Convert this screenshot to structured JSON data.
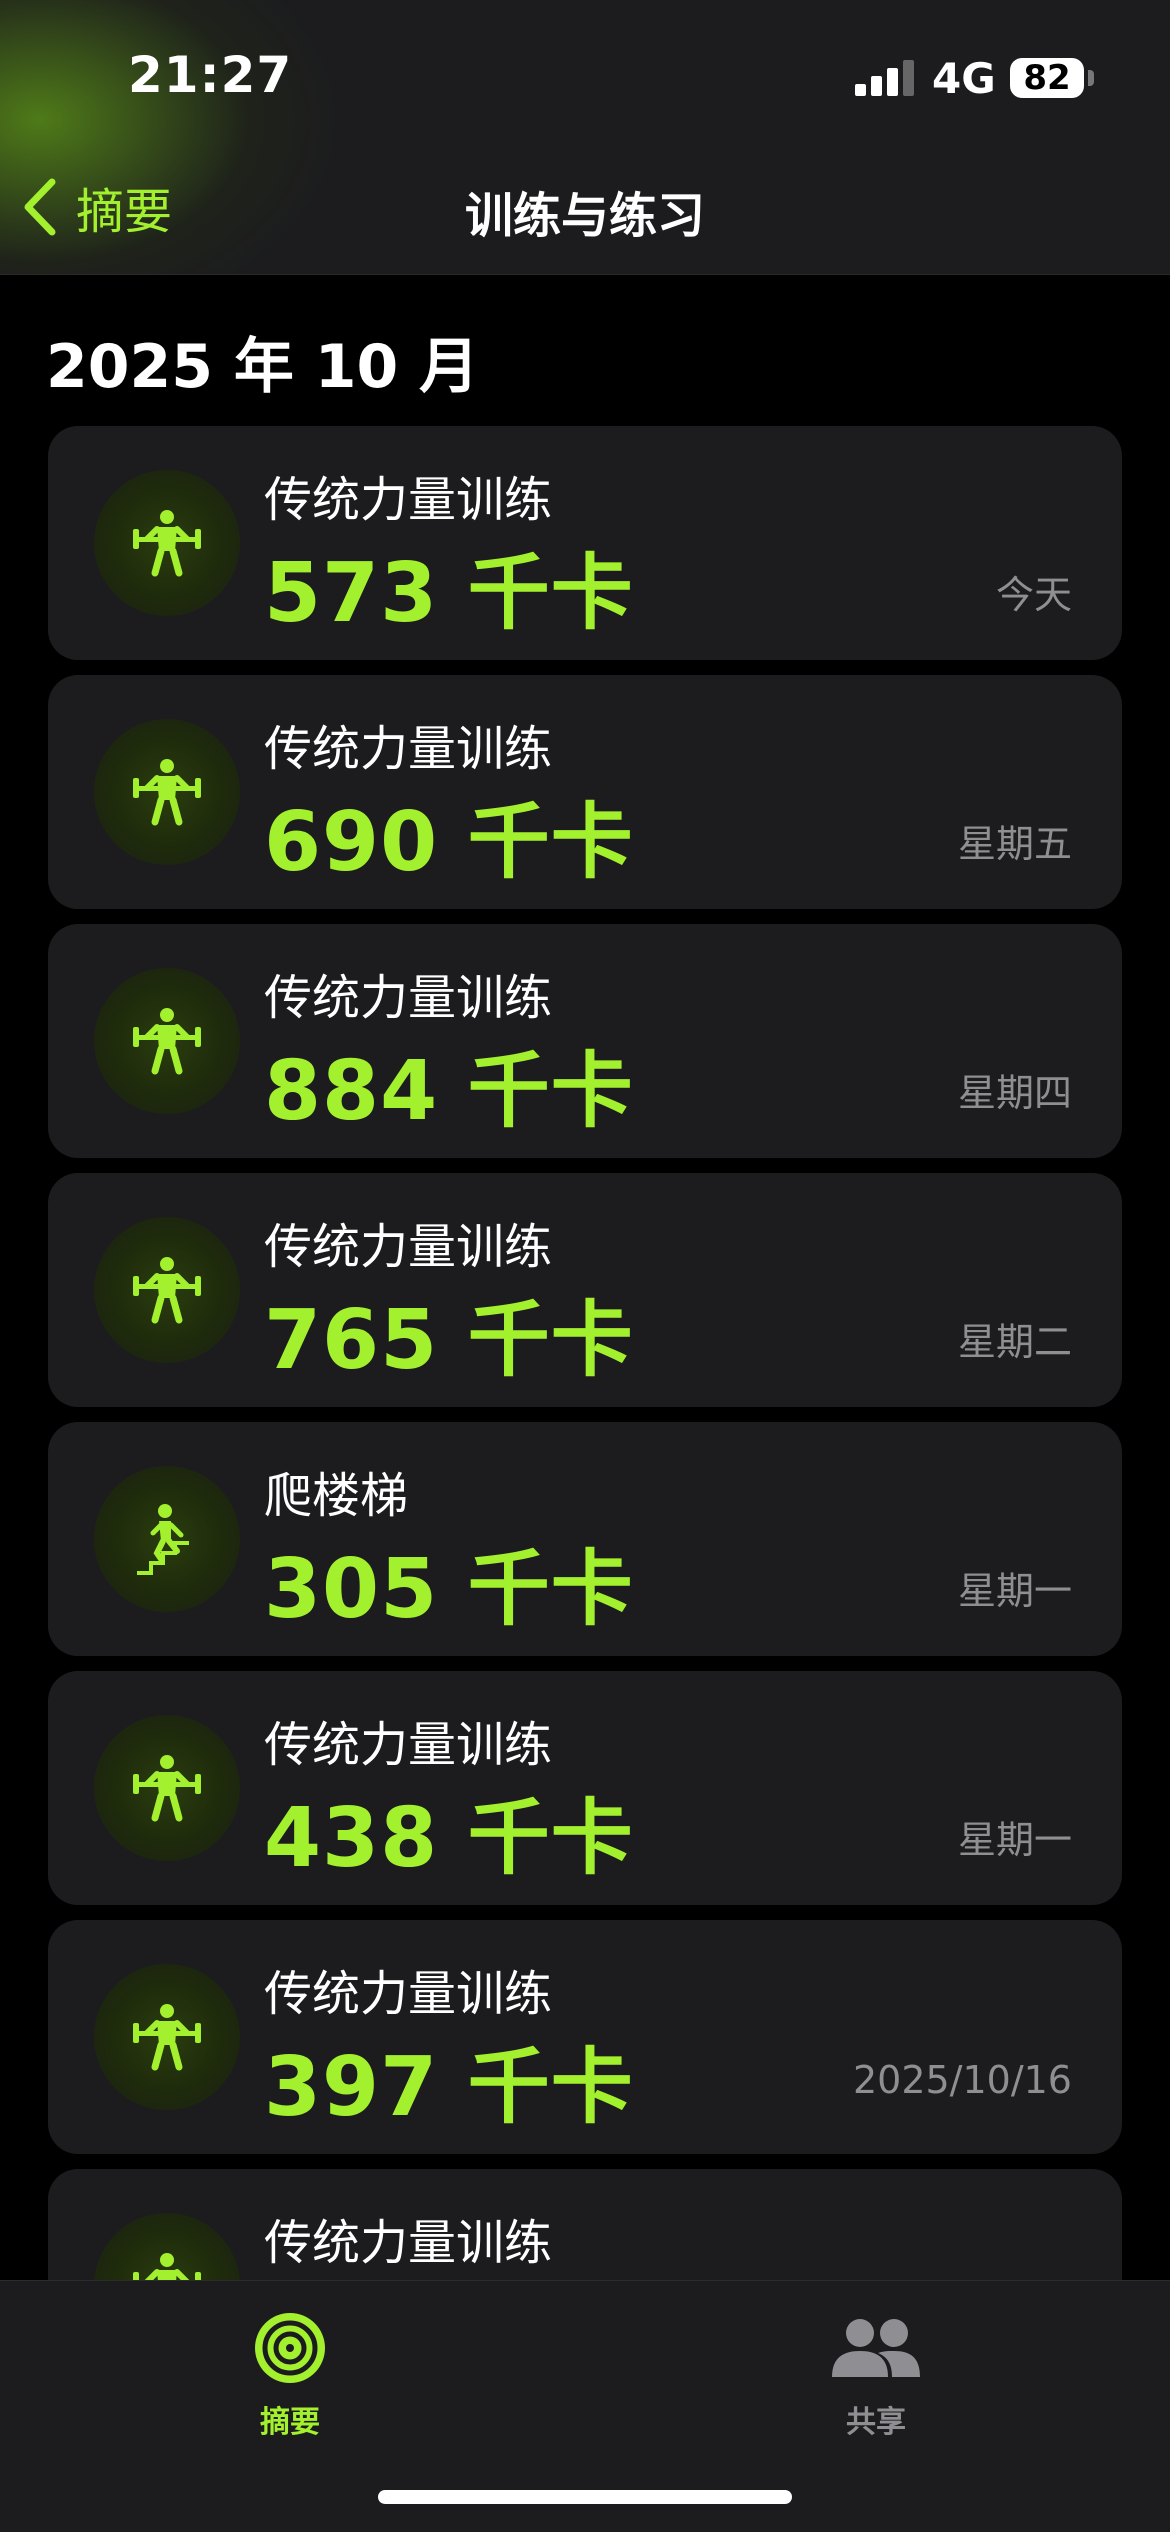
{
  "status_bar": {
    "time": "21:27",
    "network": "4G",
    "battery": "82"
  },
  "nav": {
    "back_label": "摘要",
    "title": "训练与练习"
  },
  "month_header": "2025 年 10 月",
  "workouts": [
    {
      "type": "strength",
      "icon": "weightlifting-icon",
      "title": "传统力量训练",
      "value": "573 千卡",
      "date": "今天"
    },
    {
      "type": "strength",
      "icon": "weightlifting-icon",
      "title": "传统力量训练",
      "value": "690 千卡",
      "date": "星期五"
    },
    {
      "type": "strength",
      "icon": "weightlifting-icon",
      "title": "传统力量训练",
      "value": "884 千卡",
      "date": "星期四"
    },
    {
      "type": "strength",
      "icon": "weightlifting-icon",
      "title": "传统力量训练",
      "value": "765 千卡",
      "date": "星期二"
    },
    {
      "type": "stairs",
      "icon": "stair-climbing-icon",
      "title": "爬楼梯",
      "value": "305 千卡",
      "date": "星期一"
    },
    {
      "type": "strength",
      "icon": "weightlifting-icon",
      "title": "传统力量训练",
      "value": "438 千卡",
      "date": "星期一"
    },
    {
      "type": "strength",
      "icon": "weightlifting-icon",
      "title": "传统力量训练",
      "value": "397 千卡",
      "date": "2025/10/16"
    },
    {
      "type": "strength",
      "icon": "weightlifting-icon",
      "title": "传统力量训练",
      "value": "",
      "date": ""
    }
  ],
  "tabs": [
    {
      "label": "摘要",
      "icon": "activity-rings-icon",
      "active": true
    },
    {
      "label": "共享",
      "icon": "people-icon",
      "active": false
    }
  ],
  "colors": {
    "accent": "#a3f02f",
    "background": "#000000",
    "card": "#1c1c1e",
    "secondary_text": "#8e8e93"
  }
}
